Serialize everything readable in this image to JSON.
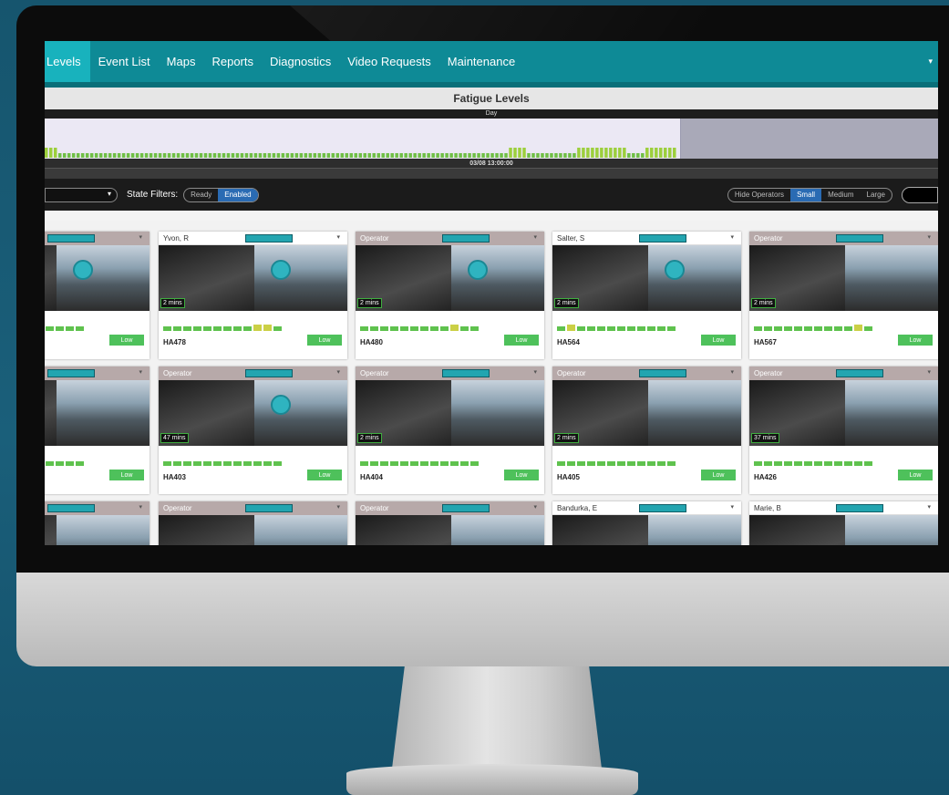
{
  "nav": {
    "tabs": [
      "Levels",
      "Event List",
      "Maps",
      "Reports",
      "Diagnostics",
      "Video Requests",
      "Maintenance"
    ],
    "active_tab": "Levels",
    "dropdown_icon": "chevron-down-icon"
  },
  "page_title": "Fatigue Levels",
  "timeline": {
    "period_label": "Day",
    "time_label": "03/08 13:00:00"
  },
  "toolbar": {
    "state_filters_label": "State Filters:",
    "state_filters": [
      "Ready",
      "Enabled"
    ],
    "active_state_filter": "Enabled",
    "size_options": [
      "Hide Operators",
      "Small",
      "Medium",
      "Large"
    ],
    "active_size": "Small"
  },
  "cards": [
    {
      "operator": "",
      "id": "",
      "mins": "",
      "level": "Low"
    },
    {
      "operator": "Yvon, R",
      "id": "HA478",
      "mins": "2 mins",
      "level": "Low"
    },
    {
      "operator": "Operator",
      "id": "HA480",
      "mins": "2 mins",
      "level": "Low"
    },
    {
      "operator": "Salter, S",
      "id": "HA564",
      "mins": "2 mins",
      "level": "Low"
    },
    {
      "operator": "Operator",
      "id": "HA567",
      "mins": "2 mins",
      "level": "Low"
    },
    {
      "operator": "",
      "id": "",
      "mins": "",
      "level": "Low"
    },
    {
      "operator": "Operator",
      "id": "HA403",
      "mins": "47 mins",
      "level": "Low"
    },
    {
      "operator": "Operator",
      "id": "HA404",
      "mins": "2 mins",
      "level": "Low"
    },
    {
      "operator": "Operator",
      "id": "HA405",
      "mins": "2 mins",
      "level": "Low"
    },
    {
      "operator": "Operator",
      "id": "HA426",
      "mins": "37 mins",
      "level": "Low"
    },
    {
      "operator": "",
      "id": "",
      "mins": "",
      "level": ""
    },
    {
      "operator": "Operator",
      "id": "",
      "mins": "",
      "level": ""
    },
    {
      "operator": "Operator",
      "id": "",
      "mins": "",
      "level": ""
    },
    {
      "operator": "Bandurka, E",
      "id": "",
      "mins": "",
      "level": ""
    },
    {
      "operator": "Marie, B",
      "id": "",
      "mins": "",
      "level": ""
    }
  ],
  "colors": {
    "nav_bg": "#0e8a96",
    "nav_active": "#18b2bd",
    "level_green": "#5fc24e",
    "level_yellow": "#cbd046",
    "low_badge": "#4ec15b"
  }
}
